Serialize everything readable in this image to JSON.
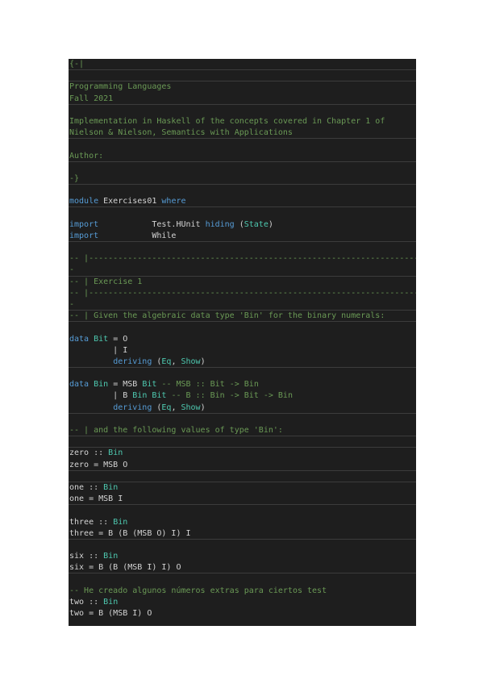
{
  "lines": [
    {
      "sep": true,
      "tokens": [
        {
          "t": "{-|",
          "c": "c"
        }
      ]
    },
    {
      "sep": true,
      "tokens": []
    },
    {
      "sep": false,
      "tokens": [
        {
          "t": "Programming Languages",
          "c": "c"
        }
      ]
    },
    {
      "sep": true,
      "tokens": [
        {
          "t": "Fall 2021",
          "c": "c"
        }
      ]
    },
    {
      "sep": false,
      "tokens": []
    },
    {
      "sep": false,
      "tokens": [
        {
          "t": "Implementation in Haskell of the concepts covered in Chapter 1 of",
          "c": "c"
        }
      ]
    },
    {
      "sep": true,
      "tokens": [
        {
          "t": "Nielson & Nielson, Semantics with Applications",
          "c": "c"
        }
      ]
    },
    {
      "sep": false,
      "tokens": []
    },
    {
      "sep": true,
      "tokens": [
        {
          "t": "Author:",
          "c": "c"
        }
      ]
    },
    {
      "sep": false,
      "tokens": []
    },
    {
      "sep": true,
      "tokens": [
        {
          "t": "-}",
          "c": "c"
        }
      ]
    },
    {
      "sep": false,
      "tokens": []
    },
    {
      "sep": true,
      "tokens": [
        {
          "t": "module",
          "c": "k"
        },
        {
          "t": " Exercises01 ",
          "c": "p"
        },
        {
          "t": "where",
          "c": "k"
        }
      ]
    },
    {
      "sep": false,
      "tokens": []
    },
    {
      "sep": false,
      "tokens": [
        {
          "t": "import",
          "c": "k"
        },
        {
          "t": "           Test.HUnit ",
          "c": "p"
        },
        {
          "t": "hiding",
          "c": "k"
        },
        {
          "t": " (",
          "c": "p"
        },
        {
          "t": "State",
          "c": "t"
        },
        {
          "t": ")",
          "c": "p"
        }
      ]
    },
    {
      "sep": true,
      "tokens": [
        {
          "t": "import",
          "c": "k"
        },
        {
          "t": "           While",
          "c": "p"
        }
      ]
    },
    {
      "sep": false,
      "tokens": []
    },
    {
      "sep": false,
      "tokens": [
        {
          "t": "-- |---------------------------------------------------------------------",
          "c": "c"
        }
      ]
    },
    {
      "sep": true,
      "tokens": [
        {
          "t": "-",
          "c": "c"
        }
      ]
    },
    {
      "sep": false,
      "tokens": [
        {
          "t": "-- | Exercise 1",
          "c": "c"
        }
      ]
    },
    {
      "sep": false,
      "tokens": [
        {
          "t": "-- |---------------------------------------------------------------------",
          "c": "c"
        }
      ]
    },
    {
      "sep": true,
      "tokens": [
        {
          "t": "-",
          "c": "c"
        }
      ]
    },
    {
      "sep": true,
      "tokens": [
        {
          "t": "-- | Given the algebraic data type 'Bin' for the binary numerals:",
          "c": "c"
        }
      ]
    },
    {
      "sep": false,
      "tokens": []
    },
    {
      "sep": false,
      "tokens": [
        {
          "t": "data",
          "c": "k"
        },
        {
          "t": " ",
          "c": "p"
        },
        {
          "t": "Bit",
          "c": "t"
        },
        {
          "t": " = O",
          "c": "p"
        }
      ]
    },
    {
      "sep": false,
      "tokens": [
        {
          "t": "         | I",
          "c": "p"
        }
      ]
    },
    {
      "sep": true,
      "tokens": [
        {
          "t": "         ",
          "c": "p"
        },
        {
          "t": "deriving",
          "c": "k"
        },
        {
          "t": " (",
          "c": "p"
        },
        {
          "t": "Eq",
          "c": "t"
        },
        {
          "t": ", ",
          "c": "p"
        },
        {
          "t": "Show",
          "c": "t"
        },
        {
          "t": ")",
          "c": "p"
        }
      ]
    },
    {
      "sep": false,
      "tokens": []
    },
    {
      "sep": false,
      "tokens": [
        {
          "t": "data",
          "c": "k"
        },
        {
          "t": " ",
          "c": "p"
        },
        {
          "t": "Bin",
          "c": "t"
        },
        {
          "t": " = MSB ",
          "c": "p"
        },
        {
          "t": "Bit",
          "c": "t"
        },
        {
          "t": " -- MSB :: Bit -> Bin",
          "c": "c"
        }
      ]
    },
    {
      "sep": false,
      "tokens": [
        {
          "t": "         | B ",
          "c": "p"
        },
        {
          "t": "Bin",
          "c": "t"
        },
        {
          "t": " ",
          "c": "p"
        },
        {
          "t": "Bit",
          "c": "t"
        },
        {
          "t": " -- B :: Bin -> Bit -> Bin",
          "c": "c"
        }
      ]
    },
    {
      "sep": true,
      "tokens": [
        {
          "t": "         ",
          "c": "p"
        },
        {
          "t": "deriving",
          "c": "k"
        },
        {
          "t": " (",
          "c": "p"
        },
        {
          "t": "Eq",
          "c": "t"
        },
        {
          "t": ", ",
          "c": "p"
        },
        {
          "t": "Show",
          "c": "t"
        },
        {
          "t": ")",
          "c": "p"
        }
      ]
    },
    {
      "sep": false,
      "tokens": []
    },
    {
      "sep": true,
      "tokens": [
        {
          "t": "-- | and the following values of type 'Bin':",
          "c": "c"
        }
      ]
    },
    {
      "sep": true,
      "tokens": []
    },
    {
      "sep": false,
      "tokens": [
        {
          "t": "zero :: ",
          "c": "p"
        },
        {
          "t": "Bin",
          "c": "t"
        }
      ]
    },
    {
      "sep": true,
      "tokens": [
        {
          "t": "zero = MSB O",
          "c": "p"
        }
      ]
    },
    {
      "sep": true,
      "tokens": []
    },
    {
      "sep": false,
      "tokens": [
        {
          "t": "one :: ",
          "c": "p"
        },
        {
          "t": "Bin",
          "c": "t"
        }
      ]
    },
    {
      "sep": true,
      "tokens": [
        {
          "t": "one = MSB I",
          "c": "p"
        }
      ]
    },
    {
      "sep": false,
      "tokens": []
    },
    {
      "sep": false,
      "tokens": [
        {
          "t": "three :: ",
          "c": "p"
        },
        {
          "t": "Bin",
          "c": "t"
        }
      ]
    },
    {
      "sep": true,
      "tokens": [
        {
          "t": "three = B (B (MSB O) I) I",
          "c": "p"
        }
      ]
    },
    {
      "sep": false,
      "tokens": []
    },
    {
      "sep": false,
      "tokens": [
        {
          "t": "six :: ",
          "c": "p"
        },
        {
          "t": "Bin",
          "c": "t"
        }
      ]
    },
    {
      "sep": true,
      "tokens": [
        {
          "t": "six = B (B (MSB I) I) O",
          "c": "p"
        }
      ]
    },
    {
      "sep": false,
      "tokens": []
    },
    {
      "sep": false,
      "tokens": [
        {
          "t": "-- He creado algunos números extras para ciertos test",
          "c": "c"
        }
      ]
    },
    {
      "sep": false,
      "tokens": [
        {
          "t": "two :: ",
          "c": "p"
        },
        {
          "t": "Bin",
          "c": "t"
        }
      ]
    },
    {
      "sep": false,
      "tokens": [
        {
          "t": "two = B (MSB I) O",
          "c": "p"
        }
      ]
    }
  ]
}
